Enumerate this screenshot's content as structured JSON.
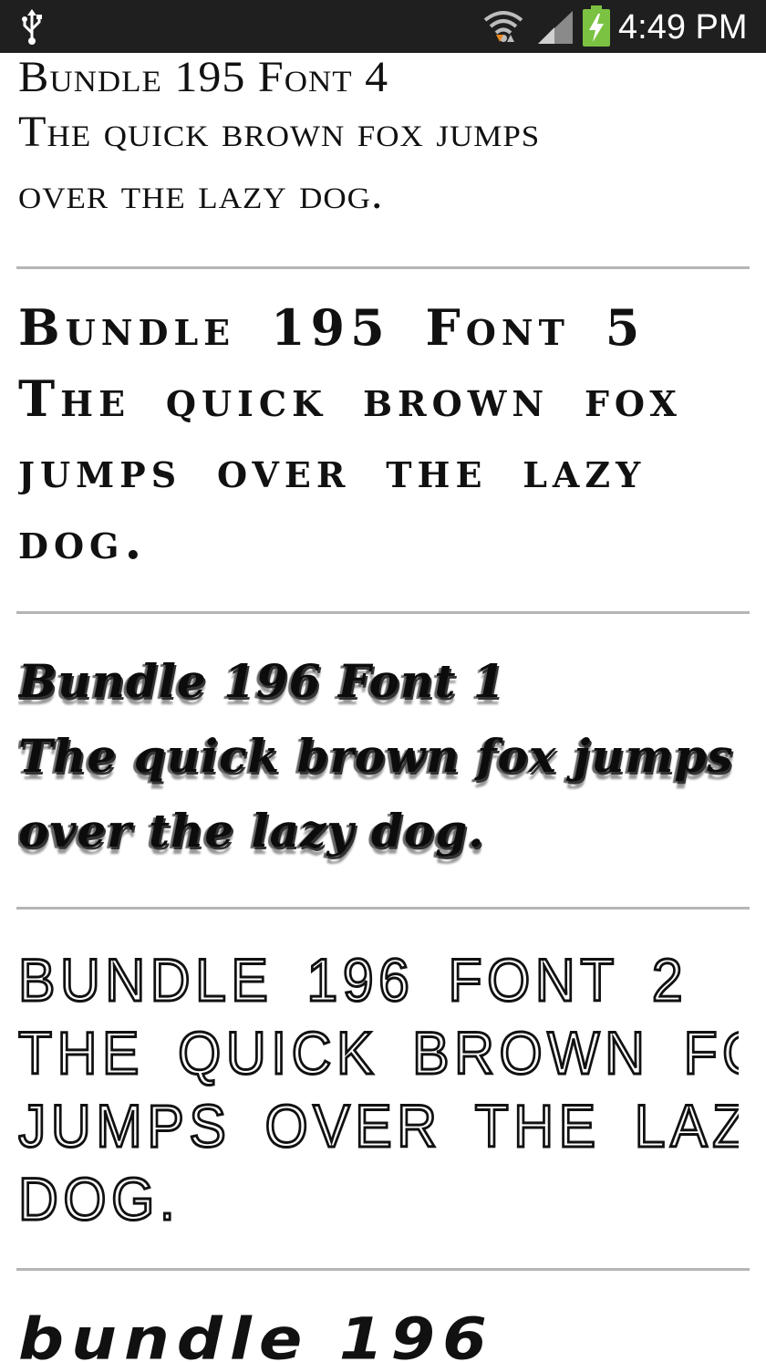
{
  "status_bar": {
    "time": "4:49 PM",
    "icons": [
      "usb-icon",
      "wifi-icon",
      "signal-icon",
      "battery-charging-icon"
    ],
    "background_color": "#1f1f1f",
    "battery_color": "#7cc242"
  },
  "font_list": {
    "items": [
      {
        "title": "Bundle 195 Font 4",
        "sample_lines": [
          "The quick brown fox jumps",
          "over the lazy dog."
        ]
      },
      {
        "title": "Bundle 195 Font 5",
        "sample_lines": [
          "The quick brown fox",
          "jumps over the lazy",
          "dog."
        ]
      },
      {
        "title": "Bundle 196 Font 1",
        "sample_lines": [
          "The quick brown fox jumps",
          "over the lazy dog."
        ]
      },
      {
        "title": "BUNDLE 196 FONT 2",
        "sample_lines": [
          "THE QUICK BROWN FOX",
          "JUMPS OVER THE LAZY",
          "DOG."
        ]
      },
      {
        "title": "bundle 196",
        "sample_lines": []
      }
    ],
    "divider_color": "#b5b5b5"
  }
}
